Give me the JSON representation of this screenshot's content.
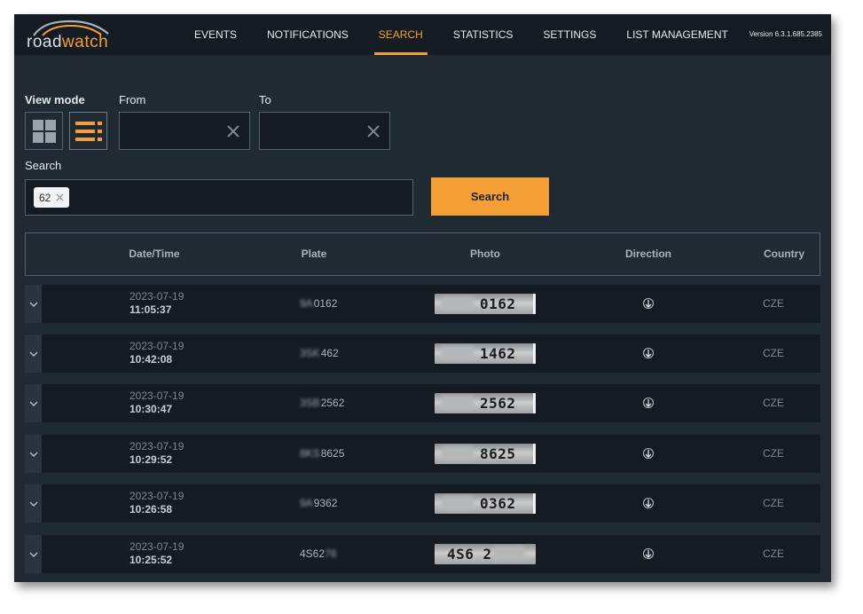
{
  "app": {
    "logo_road": "road",
    "logo_watch": "watch",
    "version": "Version 6.3.1.685.2385"
  },
  "nav": [
    {
      "label": "EVENTS",
      "active": false
    },
    {
      "label": "NOTIFICATIONS",
      "active": false
    },
    {
      "label": "SEARCH",
      "active": true
    },
    {
      "label": "STATISTICS",
      "active": false
    },
    {
      "label": "SETTINGS",
      "active": false
    },
    {
      "label": "LIST MANAGEMENT",
      "active": false
    }
  ],
  "filters": {
    "view_mode_label": "View mode",
    "view_modes": [
      "grid-view-icon",
      "list-view-icon"
    ],
    "from_label": "From",
    "from_value": "",
    "to_label": "To",
    "to_value": "",
    "search_label": "Search",
    "search_chips": [
      "62"
    ],
    "search_button": "Search"
  },
  "table": {
    "columns": [
      "Date/Time",
      "Plate",
      "Photo",
      "Direction",
      "Country"
    ],
    "rows": [
      {
        "date": "2023-07-19",
        "time": "11:05:37",
        "plate_hidden": "9A",
        "plate": "0162",
        "photo_plate": "0162",
        "direction": "arrow-down-icon",
        "country": "CZE"
      },
      {
        "date": "2023-07-19",
        "time": "10:42:08",
        "plate_hidden": "3SK",
        "plate": "462",
        "photo_plate": "1462",
        "direction": "arrow-down-icon",
        "country": "CZE"
      },
      {
        "date": "2023-07-19",
        "time": "10:30:47",
        "plate_hidden": "3SB",
        "plate": "2562",
        "photo_plate": "2562",
        "direction": "arrow-down-icon",
        "country": "CZE"
      },
      {
        "date": "2023-07-19",
        "time": "10:29:52",
        "plate_hidden": "8KS",
        "plate": "8625",
        "photo_plate": "8625",
        "direction": "arrow-down-icon",
        "country": "CZE"
      },
      {
        "date": "2023-07-19",
        "time": "10:26:58",
        "plate_hidden": "9A",
        "plate": "9362",
        "photo_plate": "0362",
        "direction": "arrow-down-icon",
        "country": "CZE"
      },
      {
        "date": "2023-07-19",
        "time": "10:25:52",
        "plate_hidden": "",
        "plate": "4S62",
        "plate_suffix_hidden": "76",
        "photo_plate": "4S6 2",
        "direction": "arrow-down-icon",
        "country": "CZE"
      }
    ]
  },
  "colors": {
    "accent": "#f5a036",
    "background": "#1f2a33",
    "topbar": "#141b22",
    "row": "#141b22"
  }
}
